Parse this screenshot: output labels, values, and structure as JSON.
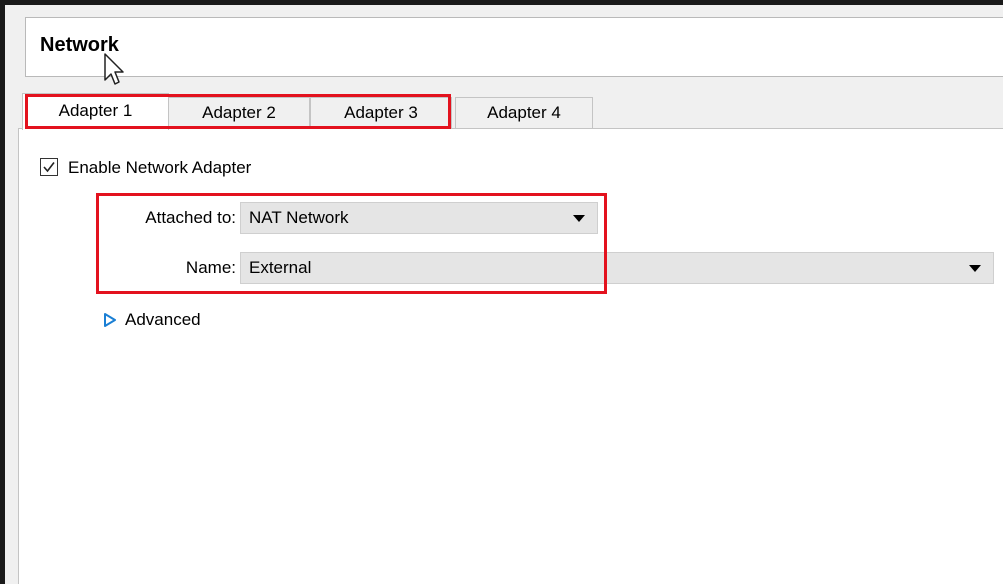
{
  "header": {
    "title": "Network"
  },
  "tabs": [
    {
      "label": "Adapter 1",
      "active": true
    },
    {
      "label": "Adapter 2",
      "active": false
    },
    {
      "label": "Adapter 3",
      "active": false
    },
    {
      "label": "Adapter 4",
      "active": false
    }
  ],
  "adapter": {
    "enable_label": "Enable Network Adapter",
    "enable_checked": true,
    "attached_to_label": "Attached to:",
    "attached_to_value": "NAT Network",
    "name_label": "Name:",
    "name_value": "External",
    "advanced_label": "Advanced"
  },
  "colors": {
    "highlight_box": "#e3121e",
    "advanced_arrow": "#1a7fd4",
    "combo_background": "#e5e5e5",
    "dialog_background": "#f0f0f0"
  },
  "icons": {
    "cursor": "mouse-pointer-icon",
    "checkbox": "checkmark-icon",
    "dropdown": "triangle-down-icon",
    "expander": "triangle-right-icon"
  }
}
